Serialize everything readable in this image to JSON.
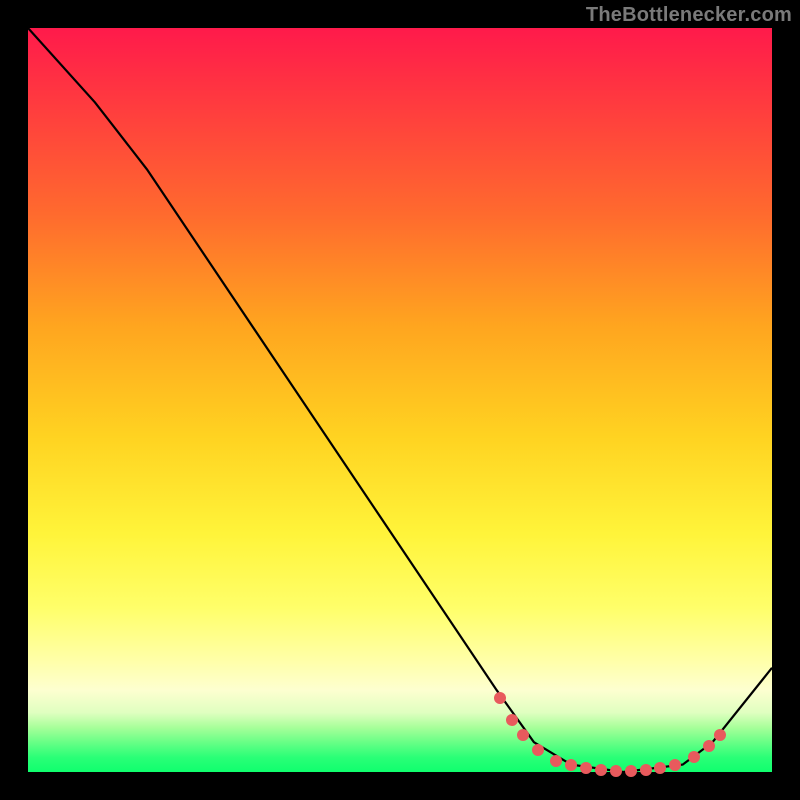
{
  "attribution": "TheBottlenecker.com",
  "chart_data": {
    "type": "line",
    "title": "",
    "xlabel": "",
    "ylabel": "",
    "xlim": [
      0,
      100
    ],
    "ylim": [
      0,
      100
    ],
    "series": [
      {
        "name": "curve",
        "points": [
          {
            "x": 0,
            "y": 100
          },
          {
            "x": 9,
            "y": 90
          },
          {
            "x": 16,
            "y": 81
          },
          {
            "x": 63,
            "y": 11
          },
          {
            "x": 68,
            "y": 4
          },
          {
            "x": 73,
            "y": 1
          },
          {
            "x": 80,
            "y": 0
          },
          {
            "x": 88,
            "y": 1
          },
          {
            "x": 92,
            "y": 4
          },
          {
            "x": 100,
            "y": 14
          }
        ]
      }
    ],
    "markers": [
      {
        "x": 63.5,
        "y": 10
      },
      {
        "x": 65,
        "y": 7
      },
      {
        "x": 66.5,
        "y": 5
      },
      {
        "x": 68.5,
        "y": 3
      },
      {
        "x": 71,
        "y": 1.5
      },
      {
        "x": 73,
        "y": 1
      },
      {
        "x": 75,
        "y": 0.5
      },
      {
        "x": 77,
        "y": 0.3
      },
      {
        "x": 79,
        "y": 0.2
      },
      {
        "x": 81,
        "y": 0.2
      },
      {
        "x": 83,
        "y": 0.3
      },
      {
        "x": 85,
        "y": 0.6
      },
      {
        "x": 87,
        "y": 1
      },
      {
        "x": 89.5,
        "y": 2
      },
      {
        "x": 91.5,
        "y": 3.5
      },
      {
        "x": 93,
        "y": 5
      }
    ],
    "background_gradient_stops": [
      {
        "pct": 0,
        "color": "#ff1a4b"
      },
      {
        "pct": 25,
        "color": "#ff6a2e"
      },
      {
        "pct": 55,
        "color": "#ffd321"
      },
      {
        "pct": 78,
        "color": "#ffff6a"
      },
      {
        "pct": 92,
        "color": "#a8ff9a"
      },
      {
        "pct": 100,
        "color": "#0fff6e"
      }
    ]
  }
}
